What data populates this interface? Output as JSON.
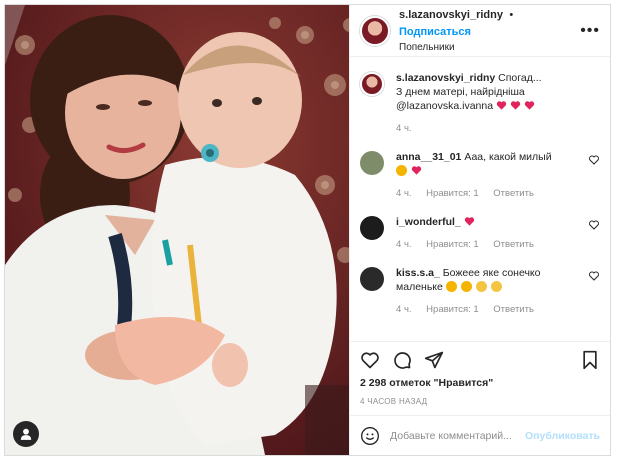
{
  "header": {
    "username": "s.lazanovskyi_ridny",
    "separator": "•",
    "follow_label": "Подписаться",
    "location": "Попельники",
    "more_label": "•••"
  },
  "caption": {
    "username": "s.lazanovskyi_ridny",
    "text": "Спогад...",
    "line2": "З днем матері, найрідніша",
    "mention": "@lazanovska.ivanna",
    "time": "4 ч."
  },
  "comments": [
    {
      "username": "anna__31_01",
      "text": "Ааа, какой милый",
      "time": "4 ч.",
      "likes": "Нравится: 1",
      "reply": "Ответить",
      "avatar_color": "#7f8c6a"
    },
    {
      "username": "i_wonderful_",
      "text": "",
      "time": "4 ч.",
      "likes": "Нравится: 1",
      "reply": "Ответить",
      "avatar_color": "#1c1c1c"
    },
    {
      "username": "kiss.s.a_",
      "text": "Божеее яке сонечко маленьке",
      "time": "4 ч.",
      "likes": "Нравится: 1",
      "reply": "Ответить",
      "avatar_color": "#2a2a2a"
    }
  ],
  "likes_text": "2 298 отметок \"Нравится\"",
  "timestamp": "4 ЧАСОВ НАЗАД",
  "add_comment": {
    "placeholder": "Добавьте комментарий...",
    "publish_label": "Опубликовать"
  },
  "icons": {
    "like": "heart-icon",
    "comment": "comment-icon",
    "share": "paper-plane-icon",
    "save": "bookmark-icon",
    "emoji": "smiley-icon",
    "user_tag": "user-icon"
  },
  "colors": {
    "accent": "#0095f6",
    "heart": "#ed4956",
    "publish_disabled": "#b2dffc"
  }
}
